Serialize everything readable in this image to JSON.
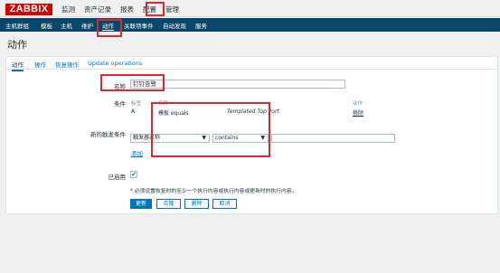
{
  "header": {
    "logo": "ZABBIX",
    "menu": [
      "监测",
      "资产记录",
      "报表",
      "配置",
      "管理"
    ]
  },
  "subnav": {
    "items": [
      "主机群组",
      "模板",
      "主机",
      "维护",
      "动作",
      "关联项事件",
      "自动发现",
      "服务"
    ]
  },
  "page": {
    "title": "动作"
  },
  "tabs": [
    "动作",
    "操作",
    "恢复操作",
    "Update operations"
  ],
  "form": {
    "name_label": "名称",
    "name_value": "钉钉告警",
    "conditions_label": "条件",
    "cond_header": {
      "label": "标签",
      "name": "名称",
      "action": "动作"
    },
    "cond_row": {
      "label": "A",
      "name_prefix": "模板 equals ",
      "name_value": "Templated Top Port",
      "remove": "移除"
    },
    "new_cond_label": "新的触发条件",
    "new_cond_type": "触发器名称",
    "new_cond_operator": "contains",
    "add_link": "添加",
    "enabled_label": "已启用",
    "enabled_check": "✔",
    "note_star": "*",
    "note_text": " 必须设置恢复时的至少一个执行内容或执行内容或更新时的执行内容。",
    "buttons": {
      "update": "更新",
      "clone": "克隆",
      "delete": "删除",
      "cancel": "取消"
    }
  },
  "colors": {
    "brand": "#d40000",
    "nav": "#0a466a",
    "link": "#0275b8",
    "highlight": "#e0262f"
  }
}
